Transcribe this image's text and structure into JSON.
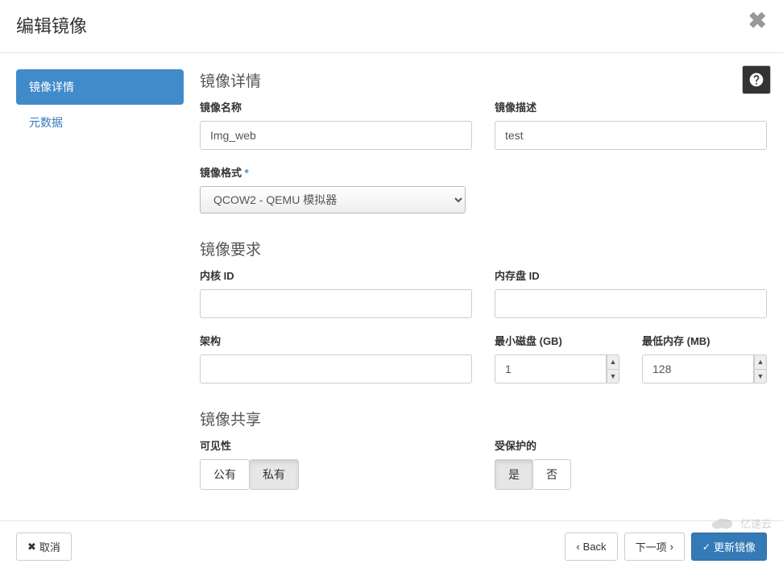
{
  "modal": {
    "title": "编辑镜像"
  },
  "sidebar": {
    "items": [
      {
        "label": "镜像详情"
      },
      {
        "label": "元数据"
      }
    ]
  },
  "sections": {
    "details": "镜像详情",
    "requirements": "镜像要求",
    "sharing": "镜像共享"
  },
  "fields": {
    "imageName": {
      "label": "镜像名称",
      "value": "Img_web"
    },
    "imageDesc": {
      "label": "镜像描述",
      "value": "test"
    },
    "imageFormat": {
      "label": "镜像格式",
      "value": "QCOW2 - QEMU 模拟器"
    },
    "kernelId": {
      "label": "内核 ID",
      "value": ""
    },
    "ramdiskId": {
      "label": "内存盘 ID",
      "value": ""
    },
    "architecture": {
      "label": "架构",
      "value": ""
    },
    "minDisk": {
      "label": "最小磁盘 (GB)",
      "value": "1"
    },
    "minRam": {
      "label": "最低内存 (MB)",
      "value": "128"
    },
    "visibility": {
      "label": "可见性"
    },
    "protected": {
      "label": "受保护的"
    }
  },
  "toggles": {
    "visibility": {
      "public": "公有",
      "private": "私有"
    },
    "protected": {
      "yes": "是",
      "no": "否"
    }
  },
  "footer": {
    "cancel": "取消",
    "back": "Back",
    "next": "下一项",
    "submit": "更新镜像"
  },
  "watermark": "亿速云"
}
